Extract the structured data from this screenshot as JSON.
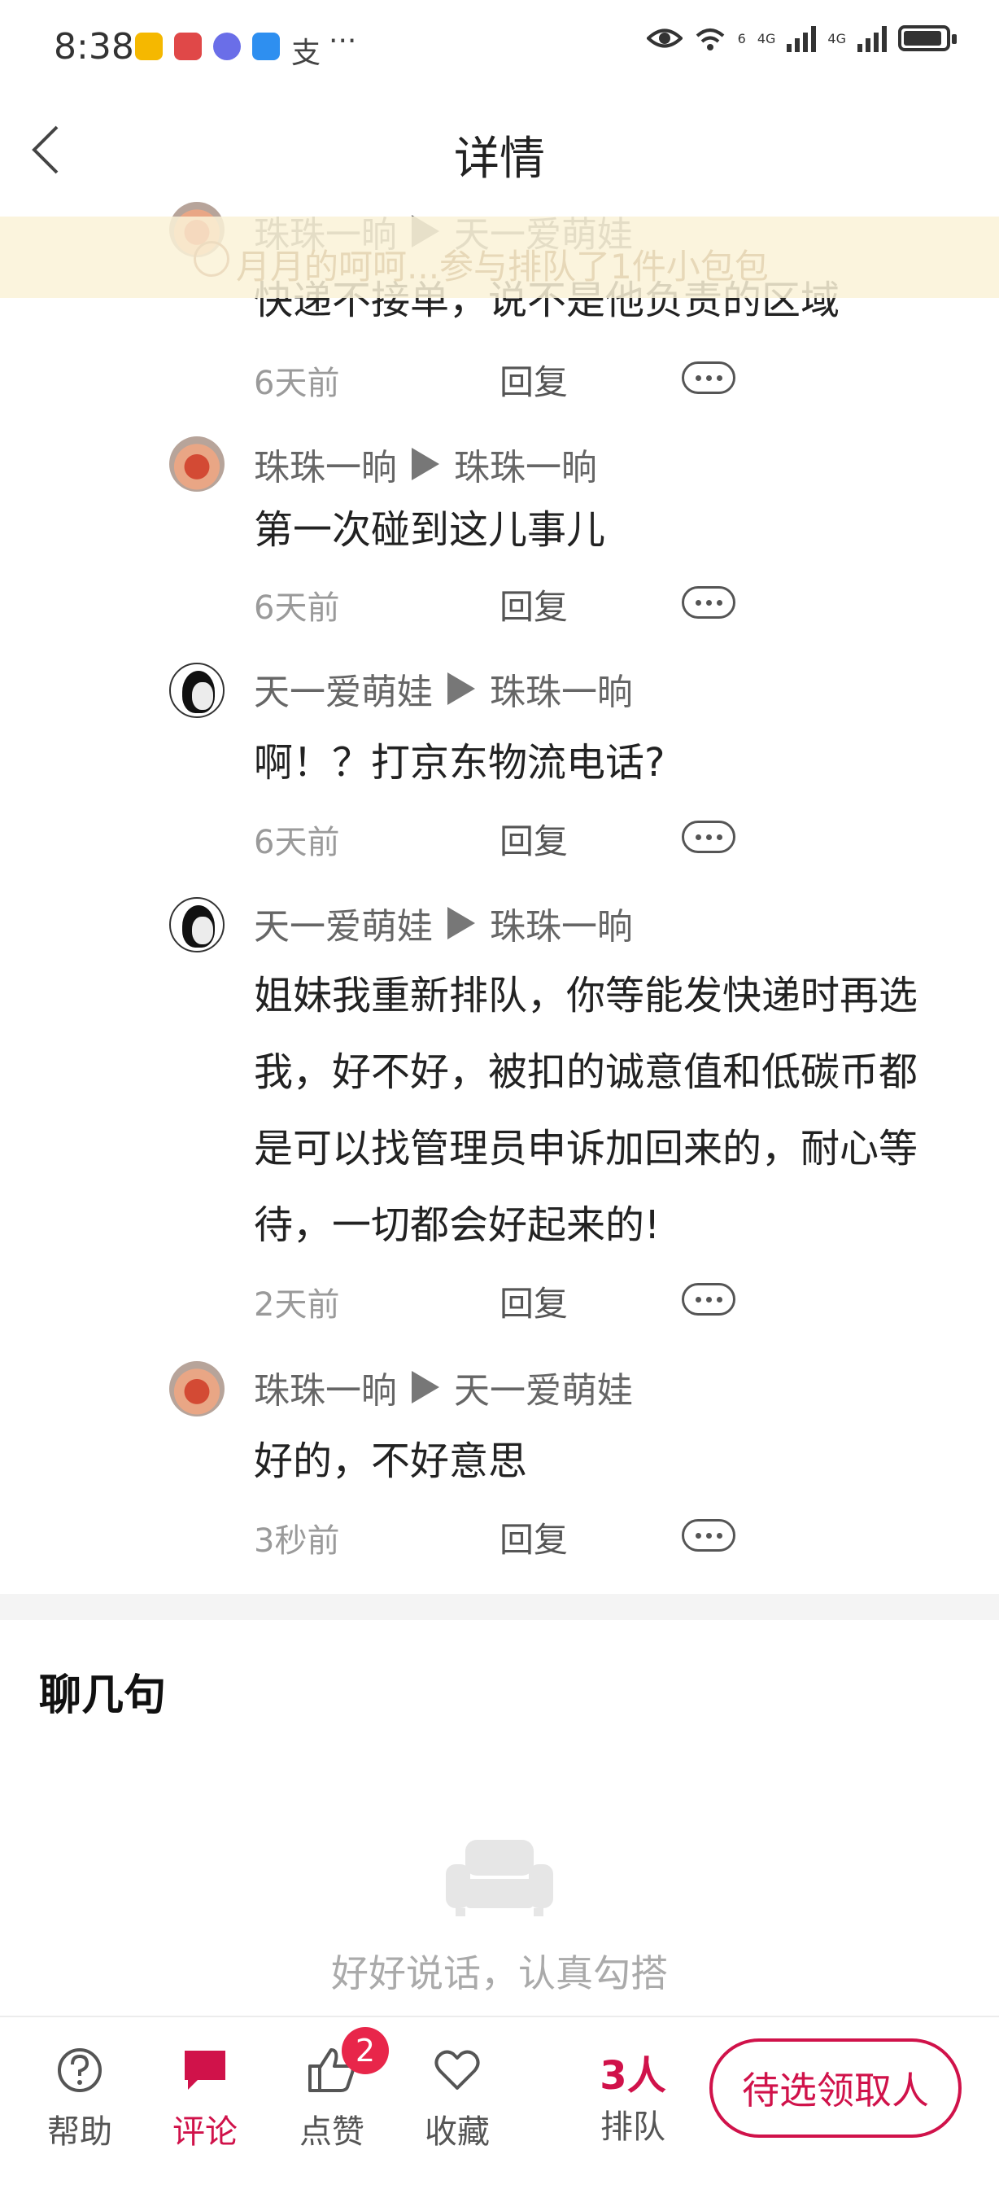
{
  "status_bar": {
    "time": "8:38",
    "more_indicator": "···",
    "net1": "6",
    "net2": "4G",
    "net3": "4G",
    "icons": [
      "lock-app-icon",
      "book-app-icon",
      "music-app-icon",
      "weather-app-icon",
      "alipay-icon",
      "eye-icon",
      "wifi-icon",
      "signal-icon",
      "battery-icon"
    ]
  },
  "header": {
    "title": "详情"
  },
  "banner": {
    "text": "月月的呵呵...参与排队了1件小包包"
  },
  "comments": [
    {
      "from": "珠珠一晌",
      "to": "天一爱萌娃",
      "text": "快递不接单，说不是他负责的区域",
      "time": "6天前",
      "reply": "回复",
      "avatar": "a"
    },
    {
      "from": "珠珠一晌",
      "to": "珠珠一晌",
      "text": "第一次碰到这儿事儿",
      "time": "6天前",
      "reply": "回复",
      "avatar": "a"
    },
    {
      "from": "天一爱萌娃",
      "to": "珠珠一晌",
      "text": "啊！？打京东物流电话?",
      "time": "6天前",
      "reply": "回复",
      "avatar": "b"
    },
    {
      "from": "天一爱萌娃",
      "to": "珠珠一晌",
      "text": "姐妹我重新排队，你等能发快递时再选我，好不好，被扣的诚意值和低碳币都是可以找管理员申诉加回来的，耐心等待，一切都会好起来的!",
      "time": "2天前",
      "reply": "回复",
      "avatar": "b"
    },
    {
      "from": "珠珠一晌",
      "to": "天一爱萌娃",
      "text": "好的，不好意思",
      "time": "3秒前",
      "reply": "回复",
      "avatar": "a"
    }
  ],
  "chat_section": {
    "title": "聊几句",
    "empty_text": "好好说话，认真勾搭"
  },
  "bottom_bar": {
    "help": "帮助",
    "comment": "评论",
    "like": "点赞",
    "like_badge": "2",
    "favorite": "收藏",
    "queue_count": "3人",
    "queue_label": "排队",
    "pick_button": "待选领取人"
  },
  "colors": {
    "accent": "#d0124a",
    "badge": "#e8264a",
    "banner_bg": "#faf2d7"
  }
}
